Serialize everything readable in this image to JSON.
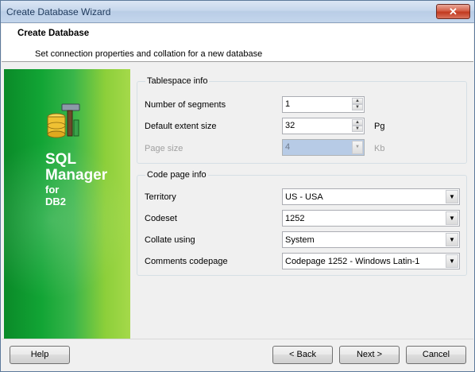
{
  "window": {
    "title": "Create Database Wizard",
    "close_glyph": "✕"
  },
  "header": {
    "title": "Create Database",
    "subtitle": "Set connection properties and collation for a new database"
  },
  "banner": {
    "line1": "SQL",
    "line2": "Manager",
    "line3": "for",
    "line4": "DB2",
    "logo_icon": "db-hammer-icon"
  },
  "tablespace": {
    "legend": "Tablespace info",
    "segments_label": "Number of segments",
    "segments_value": "1",
    "extent_label": "Default extent size",
    "extent_value": "32",
    "extent_unit": "Pg",
    "pagesize_label": "Page size",
    "pagesize_value": "4",
    "pagesize_unit": "Kb"
  },
  "codepage": {
    "legend": "Code page info",
    "territory_label": "Territory",
    "territory_value": "US - USA",
    "codeset_label": "Codeset",
    "codeset_value": "1252",
    "collate_label": "Collate using",
    "collate_value": "System",
    "comments_label": "Comments codepage",
    "comments_value": "Codepage 1252 - Windows Latin-1"
  },
  "buttons": {
    "help": "Help",
    "back": "< Back",
    "next": "Next >",
    "cancel": "Cancel"
  }
}
